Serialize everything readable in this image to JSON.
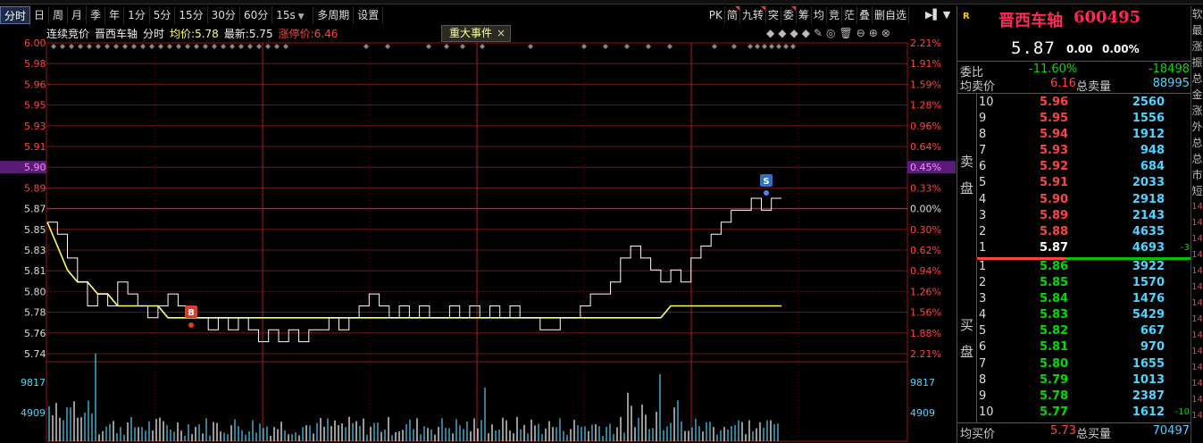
{
  "toolbar": {
    "tabs": [
      "分时",
      "日",
      "周",
      "月",
      "季",
      "年",
      "1分",
      "5分",
      "15分",
      "30分",
      "60分"
    ],
    "period_select": "15s",
    "items_after": [
      "多周期",
      "设置"
    ],
    "right_items": [
      "PK",
      "简",
      "九转",
      "突",
      "委",
      "筹",
      "均",
      "竞",
      "茫",
      "叠",
      "删自选"
    ],
    "flagged_right": [
      "简",
      "九转",
      "委"
    ]
  },
  "info": {
    "auction_label": "连续竞价",
    "stock_name": "晋西车轴",
    "mode": "分时",
    "avg_label": "均价:",
    "avg_value": "5.78",
    "last_label": "最新:",
    "last_value": "5.75",
    "limit_label": "涨停价:",
    "limit_value": "6.46"
  },
  "event_tag": {
    "label": "重大事件",
    "close": "×"
  },
  "chart_icons": [
    "◆",
    "◆",
    "◆",
    "◆",
    "✎",
    "◎",
    "🗑",
    "⊖",
    "⊕",
    "⊗"
  ],
  "chart_data": {
    "type": "line",
    "price_axis": [
      "6.00",
      "5.98",
      "5.96",
      "5.95",
      "5.93",
      "5.91",
      "5.90",
      "5.89",
      "5.87",
      "5.85",
      "5.83",
      "5.81",
      "5.80",
      "5.78",
      "5.76",
      "5.74"
    ],
    "pct_axis": [
      "2.21%",
      "1.91%",
      "1.59%",
      "1.28%",
      "0.96%",
      "0.64%",
      "0.45%",
      "0.33%",
      "0.00%",
      "0.30%",
      "0.62%",
      "0.94%",
      "1.26%",
      "1.56%",
      "1.88%",
      "2.21%"
    ],
    "highlight_price": "5.90",
    "highlight_pct": "0.45%",
    "ylim": [
      5.73,
      6.0
    ],
    "prev_close": 5.87,
    "volume_axis": [
      "9817",
      "4909"
    ],
    "markers": [
      {
        "label": "B",
        "index": 58,
        "price": 5.765
      },
      {
        "label": "S",
        "index": 282,
        "price": 5.875
      }
    ],
    "price_series": [
      5.85,
      5.84,
      5.82,
      5.8,
      5.78,
      5.79,
      5.78,
      5.8,
      5.79,
      5.78,
      5.77,
      5.78,
      5.79,
      5.78,
      5.77,
      5.77,
      5.76,
      5.77,
      5.76,
      5.77,
      5.76,
      5.75,
      5.76,
      5.75,
      5.76,
      5.75,
      5.76,
      5.76,
      5.77,
      5.76,
      5.77,
      5.78,
      5.79,
      5.78,
      5.77,
      5.78,
      5.77,
      5.78,
      5.77,
      5.77,
      5.78,
      5.77,
      5.78,
      5.77,
      5.78,
      5.77,
      5.78,
      5.77,
      5.77,
      5.76,
      5.76,
      5.77,
      5.77,
      5.78,
      5.79,
      5.79,
      5.8,
      5.82,
      5.83,
      5.82,
      5.81,
      5.8,
      5.81,
      5.8,
      5.82,
      5.83,
      5.84,
      5.85,
      5.86,
      5.86,
      5.87,
      5.86,
      5.87,
      5.87
    ],
    "avg_series": [
      5.85,
      5.83,
      5.81,
      5.8,
      5.8,
      5.79,
      5.79,
      5.78,
      5.78,
      5.78,
      5.78,
      5.78,
      5.77,
      5.77,
      5.77,
      5.77,
      5.77,
      5.77,
      5.77,
      5.77,
      5.77,
      5.77,
      5.77,
      5.77,
      5.77,
      5.77,
      5.77,
      5.77,
      5.77,
      5.77,
      5.77,
      5.77,
      5.77,
      5.77,
      5.77,
      5.77,
      5.77,
      5.77,
      5.77,
      5.77,
      5.77,
      5.77,
      5.77,
      5.77,
      5.77,
      5.77,
      5.77,
      5.77,
      5.77,
      5.77,
      5.77,
      5.77,
      5.77,
      5.77,
      5.77,
      5.77,
      5.77,
      5.77,
      5.77,
      5.77,
      5.77,
      5.77,
      5.78,
      5.78,
      5.78,
      5.78,
      5.78,
      5.78,
      5.78,
      5.78,
      5.78,
      5.78,
      5.78,
      5.78
    ]
  },
  "quote": {
    "tag": "R",
    "name": "晋西车轴",
    "code": "600495",
    "price": "5.87",
    "change": "0.00",
    "change_pct": "0.00%",
    "wb_label": "委比",
    "wb_pct": "-11.60%",
    "wb_diff": "-18498",
    "avg_sell_label": "均卖价",
    "avg_sell": "6.16",
    "total_sell_label": "总卖量",
    "total_sell": "88995",
    "sell_label": [
      "卖",
      "盘"
    ],
    "buy_label": [
      "买",
      "盘"
    ],
    "sells": [
      {
        "lvl": "10",
        "price": "5.96",
        "vol": "2560"
      },
      {
        "lvl": "9",
        "price": "5.95",
        "vol": "1556"
      },
      {
        "lvl": "8",
        "price": "5.94",
        "vol": "1912"
      },
      {
        "lvl": "7",
        "price": "5.93",
        "vol": "948"
      },
      {
        "lvl": "6",
        "price": "5.92",
        "vol": "684"
      },
      {
        "lvl": "5",
        "price": "5.91",
        "vol": "2033"
      },
      {
        "lvl": "4",
        "price": "5.90",
        "vol": "2918"
      },
      {
        "lvl": "3",
        "price": "5.89",
        "vol": "2143"
      },
      {
        "lvl": "2",
        "price": "5.88",
        "vol": "4635"
      },
      {
        "lvl": "1",
        "price": "5.87",
        "vol": "4693",
        "delta": "-3"
      }
    ],
    "buys": [
      {
        "lvl": "1",
        "price": "5.86",
        "vol": "3922"
      },
      {
        "lvl": "2",
        "price": "5.85",
        "vol": "1570"
      },
      {
        "lvl": "3",
        "price": "5.84",
        "vol": "1476"
      },
      {
        "lvl": "4",
        "price": "5.83",
        "vol": "5429"
      },
      {
        "lvl": "5",
        "price": "5.82",
        "vol": "667"
      },
      {
        "lvl": "6",
        "price": "5.81",
        "vol": "970"
      },
      {
        "lvl": "7",
        "price": "5.80",
        "vol": "1655"
      },
      {
        "lvl": "8",
        "price": "5.79",
        "vol": "1013"
      },
      {
        "lvl": "9",
        "price": "5.78",
        "vol": "2387"
      },
      {
        "lvl": "10",
        "price": "5.77",
        "vol": "1612",
        "delta": "-10"
      }
    ],
    "avg_buy_label": "均买价",
    "avg_buy": "5.73",
    "total_buy_label": "总买量",
    "total_buy": "70497"
  },
  "edge_labels": [
    "软",
    "最",
    "涨",
    "振",
    "总",
    "金",
    "涨",
    "外",
    "总",
    "总",
    "市",
    "短"
  ],
  "edge_times": [
    "14",
    "14",
    "14",
    "14",
    "14",
    "14",
    "14",
    "14",
    "14",
    "14",
    "14",
    "14",
    "14",
    "14"
  ],
  "colors": {
    "up": "#ff4444",
    "down": "#00dd00",
    "price_line": "#ffffff",
    "avg_line": "#ffff66",
    "grid": "#8b1a1a",
    "cyan": "#4ed4ff",
    "highlight_bg": "#5a1c7a"
  }
}
